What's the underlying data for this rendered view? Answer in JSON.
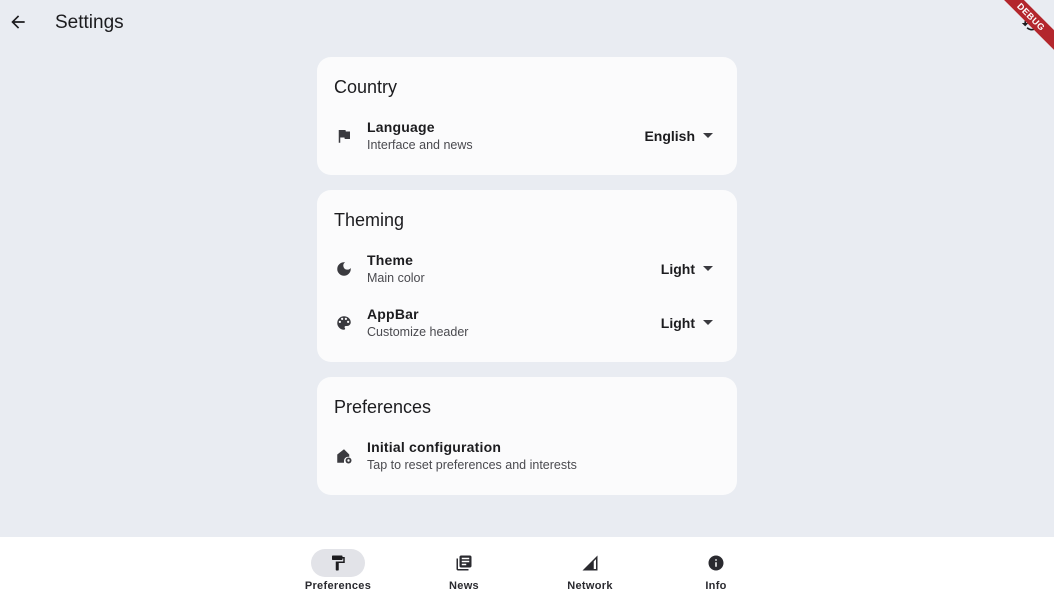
{
  "appbar": {
    "title": "Settings",
    "back_icon": "arrow-back-icon",
    "restore_icon": "restore-icon",
    "debug_label": "DEBUG"
  },
  "cards": {
    "country": {
      "title": "Country",
      "rows": [
        {
          "icon": "flag-icon",
          "title": "Language",
          "subtitle": "Interface and news",
          "value": "English"
        }
      ]
    },
    "theming": {
      "title": "Theming",
      "rows": [
        {
          "icon": "moon-icon",
          "title": "Theme",
          "subtitle": "Main color",
          "value": "Light"
        },
        {
          "icon": "palette-icon",
          "title": "AppBar",
          "subtitle": "Customize header",
          "value": "Light"
        }
      ]
    },
    "preferences": {
      "title": "Preferences",
      "rows": [
        {
          "icon": "home-settings-icon",
          "title": "Initial configuration",
          "subtitle": "Tap to reset preferences and interests"
        }
      ]
    }
  },
  "bottom_nav": {
    "items": [
      {
        "label": "Preferences",
        "icon": "paint-roller-icon",
        "active": true
      },
      {
        "label": "News",
        "icon": "newspaper-icon",
        "active": false
      },
      {
        "label": "Network",
        "icon": "signal-icon",
        "active": false
      },
      {
        "label": "Info",
        "icon": "info-icon",
        "active": false
      }
    ]
  },
  "colors": {
    "background": "#e9ecf2",
    "card": "#fbfbfc",
    "nav_background": "#ffffff",
    "active_pill": "#e2e3e8",
    "debug_ribbon": "#b3262d"
  }
}
